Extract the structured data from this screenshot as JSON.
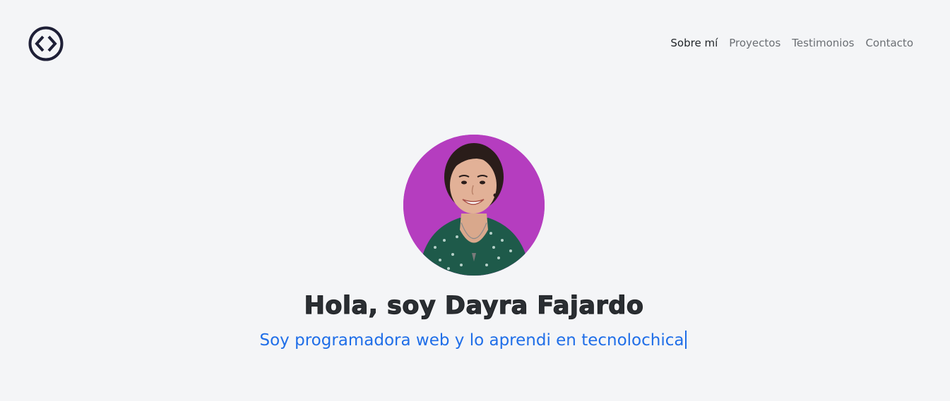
{
  "header": {
    "logo_icon": "code-brackets-icon",
    "nav": [
      {
        "label": "Sobre mí",
        "active": true
      },
      {
        "label": "Proyectos",
        "active": false
      },
      {
        "label": "Testimonios",
        "active": false
      },
      {
        "label": "Contacto",
        "active": false
      }
    ]
  },
  "hero": {
    "avatar_icon": "profile-photo",
    "avatar_bg": "#b53dbf",
    "title": "Hola, soy Dayra Fajardo",
    "subtitle": "Soy programadora web y lo aprendi en tecnolochica"
  },
  "colors": {
    "background": "#f4f5f7",
    "accent": "#1f6ee8",
    "nav_text": "#6b6f74",
    "nav_active": "#212529"
  }
}
